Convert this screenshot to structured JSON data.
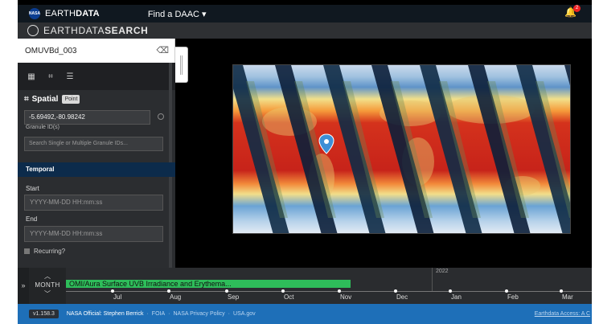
{
  "header": {
    "brand_prefix": "EARTH",
    "brand_bold": "DATA",
    "find_daac": "Find a DAAC ▾",
    "notification_count": "2",
    "app_title_prefix": "EARTHDATA",
    "app_title_bold": "SEARCH",
    "nasa_logo_text": "NASA"
  },
  "sidebar": {
    "query": "OMUVBd_003",
    "spatial_label": "Spatial",
    "spatial_type": "Point",
    "coordinates": "-5.69492,-80.98242",
    "granule_label": "Granule ID(s)",
    "granule_placeholder": "Search Single or Multiple Granule IDs...",
    "temporal_label": "Temporal",
    "start_label": "Start",
    "start_placeholder": "YYYY-MM-DD HH:mm:ss",
    "end_label": "End",
    "end_placeholder": "YYYY-MM-DD HH:mm:ss",
    "recurring_label": "Recurring?"
  },
  "timeline": {
    "zoom_label": "MONTH",
    "collection_bar": "OMI/Aura Surface UVB Irradiance and Erythema...",
    "year_label": "2022",
    "months": [
      "Jul",
      "Aug",
      "Sep",
      "Oct",
      "Nov",
      "Dec",
      "Jan",
      "Feb",
      "Mar"
    ]
  },
  "footer": {
    "version": "v1.158.3",
    "official": "NASA Official: Stephen Berrick",
    "links": [
      "FOIA",
      "NASA Privacy Policy",
      "USA.gov"
    ],
    "access": "Earthdata Access: A C"
  },
  "colors": {
    "topbar": "#101820",
    "footer": "#1e6fb8",
    "temporal_header": "#0c2b4b",
    "timeline_bar": "#2ebd5a"
  }
}
